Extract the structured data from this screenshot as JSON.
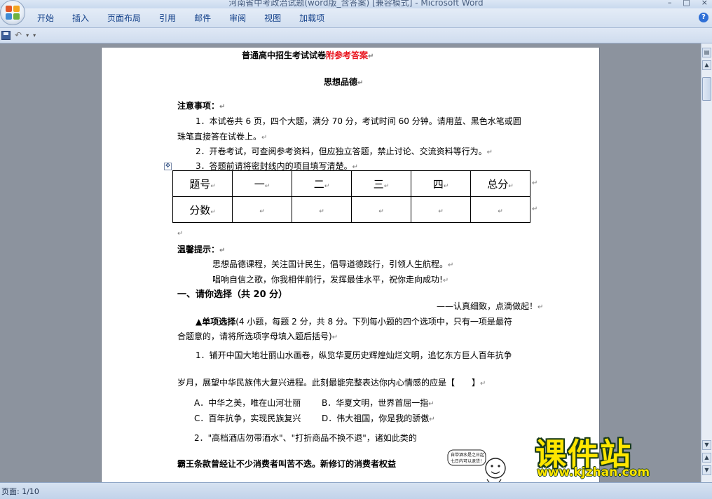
{
  "window": {
    "title": "河南省中考政治试题(word版_含答案) [兼容模式] - Microsoft Word"
  },
  "ribbon": {
    "tabs": [
      "开始",
      "插入",
      "页面布局",
      "引用",
      "邮件",
      "审阅",
      "视图",
      "加载项"
    ]
  },
  "document": {
    "title_black": "普通高中招生考试试卷",
    "title_red": "附参考答案",
    "subtitle": "思想品德",
    "notice_heading": "注意事项：",
    "notice_1a": "1．本试卷共 6 页，四个大题，满分 70 分，考试时间 60 分钟。请用蓝、黑色水笔或圆",
    "notice_1b": "珠笔直接答在试卷上。",
    "notice_2": "2．开卷考试，可查阅参考资料，但应独立答题，禁止讨论、交流资料等行为。",
    "notice_3": "3．答题前请将密封线内的项目填写清楚。",
    "score_table": {
      "header": [
        "题号",
        "一",
        "二",
        "三",
        "四",
        "总分"
      ],
      "row_label": "分数"
    },
    "tips_heading": "温馨提示：",
    "tips_1": "思想品德课程，关注国计民生，倡导道德践行，引领人生航程。",
    "tips_2": "唱响自信之歌，你我相伴前行，发挥最佳水平，祝你走向成功!",
    "section1_heading": "一、请你选择（共 20 分）",
    "section1_motto": "——认真细致，点滴做起！",
    "single_choice_label": "▲单项选择",
    "single_choice_desc_a": "(4 小题，每题 2 分，共 8 分。下列每小题的四个选项中，只有一项是最符",
    "single_choice_desc_b": "合题意的，请将所选项字母填入题后括号)",
    "q1_a": "1．铺开中国大地壮丽山水画卷，纵览华夏历史辉煌灿烂文明，追忆东方巨人百年抗争",
    "q1_b": "岁月，展望中华民族伟大复兴进程。此刻最能完整表达你内心情感的应是【　　】",
    "q1_opt_a": "A．中华之美，唯在山河壮丽",
    "q1_opt_b": "B．华夏文明，世界首屈一指",
    "q1_opt_c": "C．百年抗争，实现民族复兴",
    "q1_opt_d": "D．伟大祖国，你是我的骄傲",
    "q2_a": "2．\"高档酒店勿带酒水\"、\"打折商品不换不退\"，诸如此类的",
    "q2_b": "霸王条款曾经让不少消费者叫苦不迭。新修订的消费者权益",
    "cartoon_caption_1": "自带酒水是之日起",
    "cartoon_caption_2": "七日内可以退货！"
  },
  "status": {
    "page_label": "页面: 1/10"
  },
  "watermark": {
    "brand": "课件站",
    "url": "www.kjzhan.com"
  },
  "icons": {
    "help": "help-icon",
    "save": "save-icon",
    "undo": "undo-icon"
  }
}
